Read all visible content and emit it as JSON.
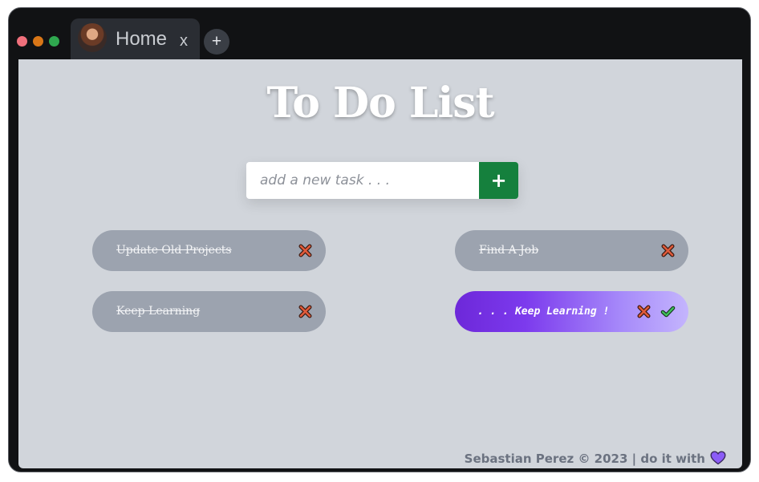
{
  "browser": {
    "tab_title": "Home",
    "tab_close_label": "x",
    "new_tab_label": "+",
    "traffic_light_colors": [
      "#f0707c",
      "#d97617",
      "#2fa84f"
    ]
  },
  "app": {
    "title": "To Do List",
    "input_placeholder": "add a new task . . .",
    "input_value": "",
    "add_button_label": "+",
    "accent_color": "#15803d",
    "tasks": [
      {
        "text": "Update Old Projects",
        "completed": true
      },
      {
        "text": "Find A Job",
        "completed": true
      },
      {
        "text": "Keep Learning",
        "completed": true
      },
      {
        "text": ". . . Keep Learning !",
        "completed": false,
        "highlighted": true
      }
    ],
    "footer": {
      "text": "Sebastian Perez © 2023 | do it with",
      "icon": "heart-icon"
    }
  }
}
